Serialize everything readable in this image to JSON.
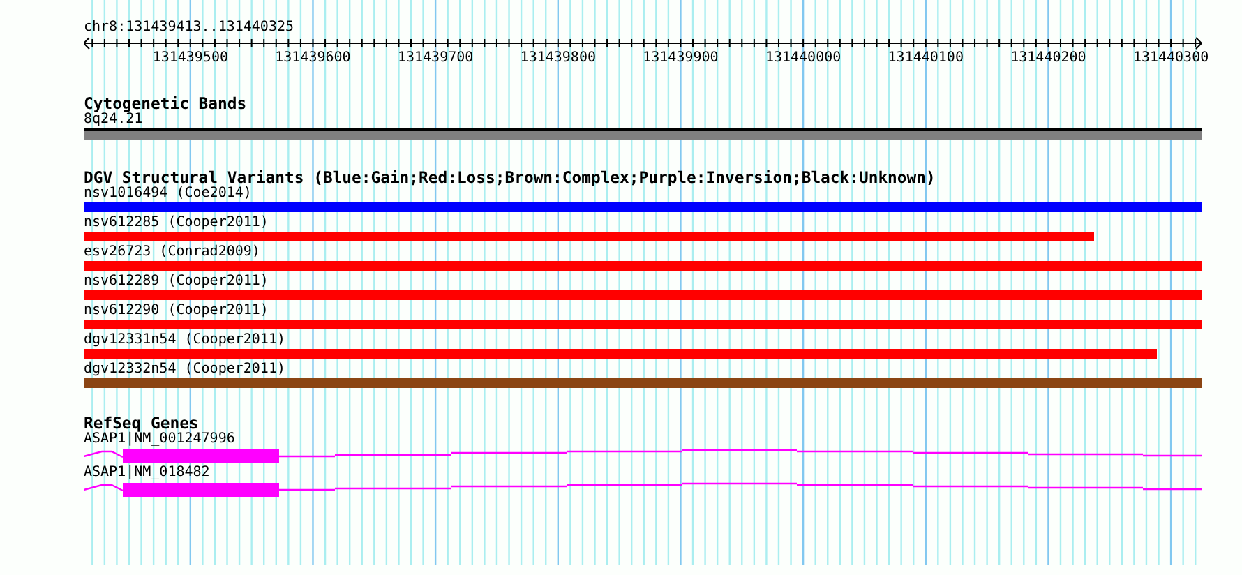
{
  "ruler": {
    "position": "chr8:131439413..131440325",
    "ticks": [
      "131439500",
      "131439600",
      "131439700",
      "131439800",
      "131439900",
      "131440000",
      "131440100",
      "131440200",
      "131440300"
    ]
  },
  "cytogenetic_bands": {
    "title": "Cytogenetic Bands",
    "band": "8q24.21"
  },
  "dgv_variants": {
    "title": "DGV Structural Variants (Blue:Gain;Red:Loss;Brown:Complex;Purple:Inversion;Black:Unknown)",
    "items": [
      {
        "label": "nsv1016494 (Coe2014)",
        "color": "#0000ff"
      },
      {
        "label": "nsv612285 (Cooper2011)",
        "color": "#ff0000"
      },
      {
        "label": "esv26723 (Conrad2009)",
        "color": "#ff0000"
      },
      {
        "label": "nsv612289 (Cooper2011)",
        "color": "#ff0000"
      },
      {
        "label": "nsv612290 (Cooper2011)",
        "color": "#ff0000"
      },
      {
        "label": "dgv12331n54 (Cooper2011)",
        "color": "#ff0000"
      },
      {
        "label": "dgv12332n54 (Cooper2011)",
        "color": "#8b4513"
      }
    ]
  },
  "refseq_genes": {
    "title": "RefSeq Genes",
    "items": [
      {
        "label": "ASAP1|NM_001247996"
      },
      {
        "label": "ASAP1|NM_018482"
      }
    ]
  }
}
